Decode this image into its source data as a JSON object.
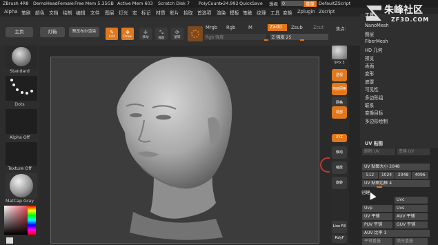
{
  "titlebar": {
    "app": "ZBrush 4R8",
    "doc": "DemoHeadFemale",
    "free_mem": "Free Mem 5.35GB",
    "active_mem": "Active Mem 603",
    "scratch": "Scratch Disk 7",
    "polycount": "PolyCount▸24.992",
    "quicksave": "QuickSave",
    "transp_label": "透视",
    "transp_value": "0",
    "menu_btn": "菜单",
    "default_script": "DefaultZScript"
  },
  "menubar": [
    "Alpha",
    "笔刷",
    "颜色",
    "文档",
    "绘制",
    "编辑",
    "文件",
    "图层",
    "灯光",
    "宏",
    "标记",
    "材质",
    "影片",
    "拾取",
    "首选项",
    "渲染",
    "模板",
    "笔触",
    "纹理",
    "工具",
    "变换",
    "Zplugin",
    "Zscript"
  ],
  "toolbar": {
    "home": "主页",
    "lightbox": "灯箱",
    "preview_render": "预览布尔渲染",
    "edit": "Edit",
    "draw": "Draw",
    "move": "移动",
    "scale": "缩放",
    "rotate": "旋转",
    "mrgb": "Mrgb",
    "rgb": "Rgb",
    "m": "M",
    "zadd": "Zadd",
    "zsub": "Zsub",
    "zcut": "Zcut",
    "rgb_intensity": "Rgb 强度",
    "z_intensity": "Z 强度 25",
    "focal": "焦点:"
  },
  "left_tray": {
    "brush": "Standard",
    "stroke": "Dots",
    "alpha": "Alpha Off",
    "texture": "Texture Off",
    "material": "MatCap Gray"
  },
  "right_tools": {
    "spix": "SPix 3",
    "items": [
      "透视",
      "地面网格",
      "网格",
      "局部",
      "XYZ",
      "移动",
      "缩放",
      "旋转",
      "Line Fill",
      "PolyF"
    ]
  },
  "logo": {
    "text": "朱峰社区",
    "url": "ZF3D.COM"
  },
  "panel": {
    "top_item": "工具",
    "items": [
      "NanoMesh",
      "图层",
      "FiberMesh",
      "HD 几何",
      "预览",
      "表面",
      "变形",
      "遮罩",
      "可见性",
      "多边形组",
      "联系",
      "变换目标",
      "多边形绘制"
    ],
    "uv_map": {
      "title": "UV 贴图",
      "delete_uv": "删除 UV",
      "morph_uv": "变换 UV",
      "uv_size": "UV 贴图大小 2048",
      "sizes": [
        "512",
        "1024",
        "2048",
        "4096"
      ],
      "uv_border": "UV 贴图边框 4",
      "create": "创建",
      "uvc": "Uvc",
      "uvp": "Uvp",
      "uvs": "Uvs",
      "uv_flat": "UV 平铺",
      "auv_flat": "AUV 平铺",
      "puv_flat": "PUV 平铺",
      "guv_flat": "GUV 平铺",
      "auv_ratio": "AUV 比率 1",
      "flat_overlap": "平铺重叠",
      "fill_overlap": "填充重叠"
    }
  },
  "colors": {
    "accent": "#e0781d",
    "red": "#c0392b",
    "bg": "#2a2a2a"
  }
}
